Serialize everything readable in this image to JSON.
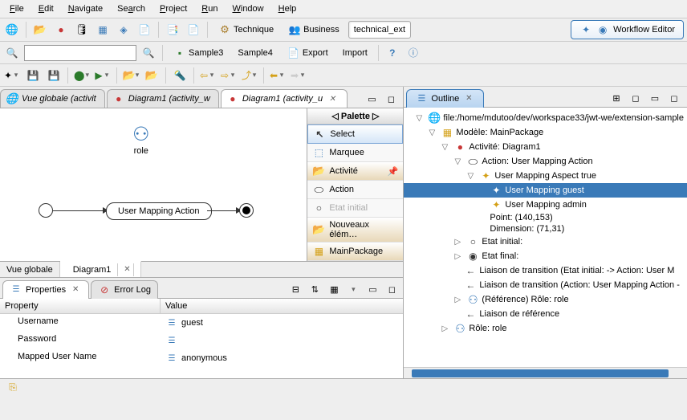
{
  "menu": {
    "file": "File",
    "edit": "Edit",
    "navigate": "Navigate",
    "search": "Search",
    "project": "Project",
    "run": "Run",
    "window": "Window",
    "help": "Help"
  },
  "toolbar1": {
    "technique": "Technique",
    "business": "Business",
    "technical_ext": "technical_ext",
    "workflow_editor": "Workflow Editor"
  },
  "toolbar2": {
    "sample3": "Sample3",
    "sample4": "Sample4",
    "export": "Export",
    "import": "Import"
  },
  "editor_tabs": {
    "t1": "Vue globale (activit",
    "t2": "Diagram1 (activity_w",
    "t3": "Diagram1 (activity_u"
  },
  "palette": {
    "header": "Palette",
    "select": "Select",
    "marquee": "Marquee",
    "activite": "Activité",
    "action": "Action",
    "etat_initial": "Etat initial",
    "nouveaux": "Nouveaux élém…",
    "main": "MainPackage"
  },
  "canvas": {
    "role": "role",
    "action": "User Mapping Action"
  },
  "canvas_tabs": {
    "t1": "Vue globale",
    "t2": "Diagram1"
  },
  "props": {
    "tab1": "Properties",
    "tab2": "Error Log",
    "col1": "Property",
    "col2": "Value",
    "r1k": "Username",
    "r1v": "guest",
    "r2k": "Password",
    "r2v": "",
    "r3k": "Mapped User Name",
    "r3v": "anonymous"
  },
  "outline": {
    "tab": "Outline",
    "n0": "file:/home/mdutoo/dev/workspace33/jwt-we/extension-sample",
    "n1": "Modèle: MainPackage",
    "n2": "Activité: Diagram1",
    "n3": "Action: User Mapping Action",
    "n4": "User Mapping Aspect true",
    "n5": "User Mapping guest",
    "n6": "User Mapping admin",
    "n7": "Point: (140,153)",
    "n8": "Dimension: (71,31)",
    "n9": "Etat initial:",
    "n10": "Etat final:",
    "n11": "Liaison de transition (Etat initial:  -> Action: User M",
    "n12": "Liaison de transition (Action: User Mapping Action  -",
    "n13": "(Référence) Rôle: role",
    "n14": "Liaison de référence",
    "n15": "Rôle: role"
  }
}
